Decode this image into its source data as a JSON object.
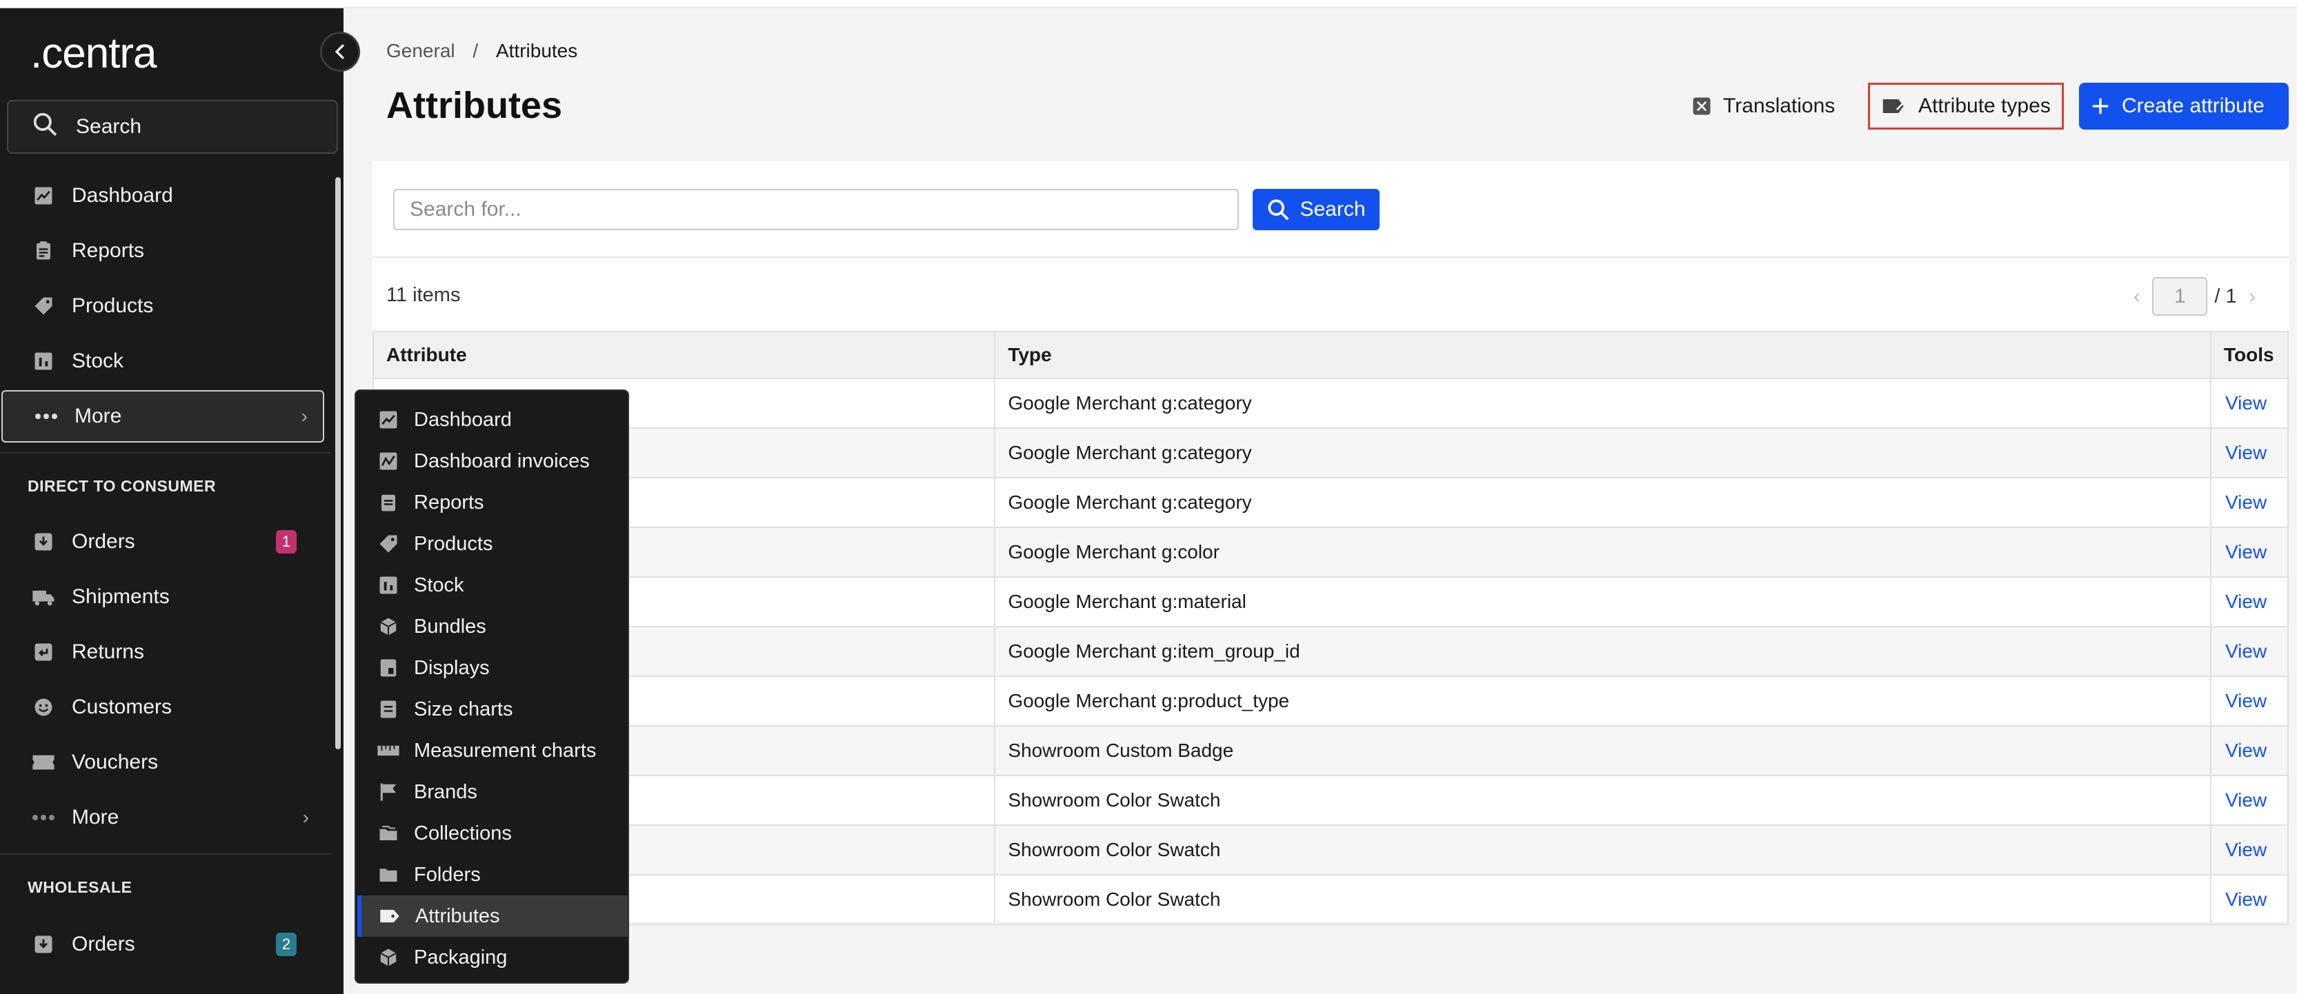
{
  "sidebar": {
    "logo": ".centra",
    "search_label": "Search",
    "top_items": [
      {
        "label": "Dashboard",
        "icon": "chart-icon"
      },
      {
        "label": "Reports",
        "icon": "clipboard-icon"
      },
      {
        "label": "Products",
        "icon": "tag-icon"
      },
      {
        "label": "Stock",
        "icon": "stock-icon"
      },
      {
        "label": "More",
        "icon": "dots-icon"
      }
    ],
    "dtc_title": "DIRECT TO CONSUMER",
    "dtc_items": [
      {
        "label": "Orders",
        "icon": "inbox-icon",
        "badge": "1"
      },
      {
        "label": "Shipments",
        "icon": "truck-icon"
      },
      {
        "label": "Returns",
        "icon": "return-icon"
      },
      {
        "label": "Customers",
        "icon": "smile-icon"
      },
      {
        "label": "Vouchers",
        "icon": "ticket-icon"
      },
      {
        "label": "More",
        "icon": "dots-icon"
      }
    ],
    "wholesale_title": "WHOLESALE",
    "wholesale_items": [
      {
        "label": "Orders",
        "icon": "inbox-icon",
        "badge": "2"
      }
    ],
    "colors": {
      "badge_dtc": "#c2326f",
      "badge_wholesale": "#2a7c8f"
    }
  },
  "flyout": {
    "items": [
      {
        "label": "Dashboard",
        "icon": "chart-icon"
      },
      {
        "label": "Dashboard invoices",
        "icon": "chart-invoice-icon"
      },
      {
        "label": "Reports",
        "icon": "clipboard-icon"
      },
      {
        "label": "Products",
        "icon": "tag-icon"
      },
      {
        "label": "Stock",
        "icon": "stock-icon"
      },
      {
        "label": "Bundles",
        "icon": "boxes-icon"
      },
      {
        "label": "Displays",
        "icon": "display-icon"
      },
      {
        "label": "Size charts",
        "icon": "size-chart-icon"
      },
      {
        "label": "Measurement charts",
        "icon": "ruler-icon"
      },
      {
        "label": "Brands",
        "icon": "flag-icon"
      },
      {
        "label": "Collections",
        "icon": "collection-icon"
      },
      {
        "label": "Folders",
        "icon": "folder-icon"
      },
      {
        "label": "Attributes",
        "icon": "attribute-icon",
        "active": true
      },
      {
        "label": "Packaging",
        "icon": "package-icon"
      }
    ]
  },
  "header": {
    "breadcrumb": {
      "parent": "General",
      "sep": "/",
      "current": "Attributes"
    },
    "title": "Attributes",
    "translations_label": "Translations",
    "attribute_types_label": "Attribute types",
    "create_label": "Create attribute"
  },
  "search": {
    "placeholder": "Search for...",
    "button_label": "Search"
  },
  "list": {
    "count_label": "11 items",
    "page": "1",
    "page_total": "/ 1",
    "columns": [
      "Attribute",
      "Type",
      "Tools"
    ],
    "rows": [
      {
        "type": "Google Merchant g:category",
        "tool": "View"
      },
      {
        "type": "Google Merchant g:category",
        "tool": "View"
      },
      {
        "type": "Google Merchant g:category",
        "tool": "View"
      },
      {
        "type": "Google Merchant g:color",
        "tool": "View"
      },
      {
        "type": "Google Merchant g:material",
        "tool": "View"
      },
      {
        "type": "Google Merchant g:item_group_id",
        "tool": "View"
      },
      {
        "type": "Google Merchant g:product_type",
        "tool": "View"
      },
      {
        "type": "Showroom Custom Badge",
        "tool": "View"
      },
      {
        "type": "Showroom Color Swatch",
        "tool": "View"
      },
      {
        "type": "Showroom Color Swatch",
        "tool": "View"
      },
      {
        "type": "Showroom Color Swatch",
        "tool": "View"
      }
    ]
  },
  "colors": {
    "primary": "#1351ee",
    "highlight_border": "#d6412f",
    "sidebar_bg": "#1a1a1a"
  }
}
